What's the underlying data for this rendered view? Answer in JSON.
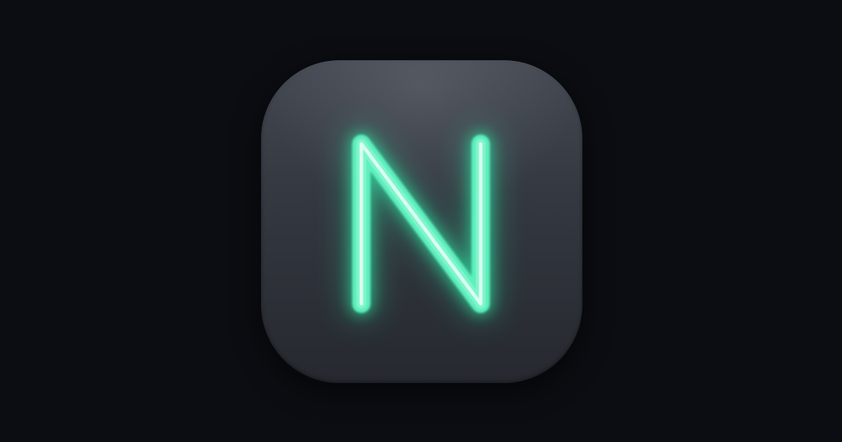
{
  "logo": {
    "letter": "N",
    "icon": "neon-n-app-icon",
    "colors": {
      "background": "#0b0d12",
      "tile_top": "#434852",
      "tile_bottom": "#26292f",
      "neon_glow": "#2ee6a6",
      "neon_tube": "#7ff5cd",
      "neon_core": "#eafff7"
    }
  }
}
